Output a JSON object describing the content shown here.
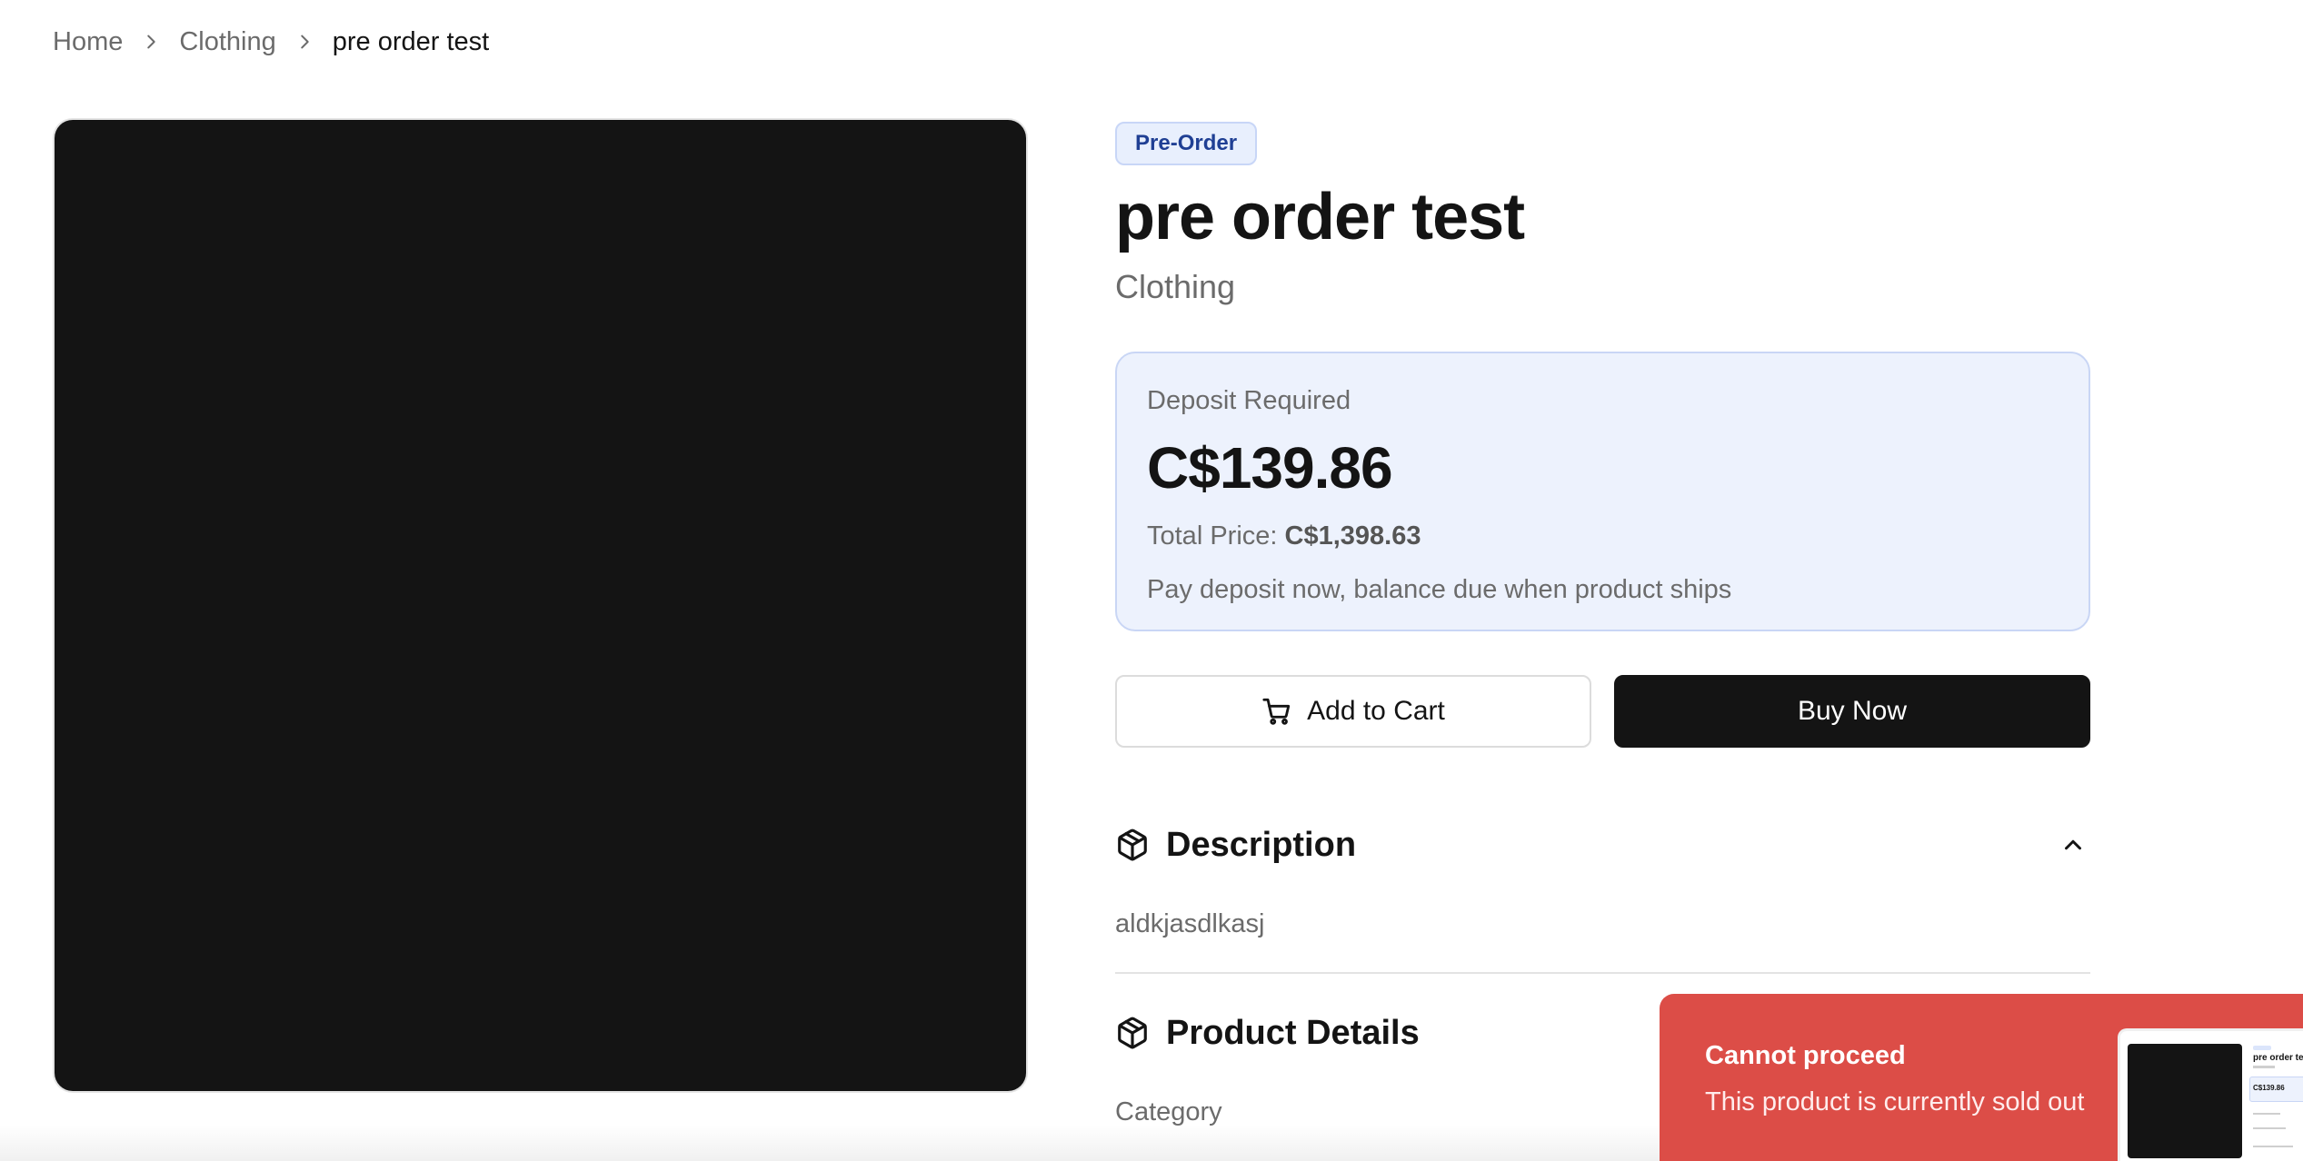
{
  "breadcrumb": {
    "items": [
      "Home",
      "Clothing"
    ],
    "current": "pre order test"
  },
  "product": {
    "badge": "Pre-Order",
    "title": "pre order test",
    "category": "Clothing"
  },
  "pricing": {
    "deposit_label": "Deposit Required",
    "deposit_amount": "C$139.86",
    "total_label": "Total Price:",
    "total_amount": "C$1,398.63",
    "note": "Pay deposit now, balance due when product ships"
  },
  "actions": {
    "add_to_cart_label": "Add to Cart",
    "buy_now_label": "Buy Now"
  },
  "sections": {
    "description_title": "Description",
    "description_text": "aldkjasdlkasj",
    "details_title": "Product Details",
    "details_first_label": "Category"
  },
  "toast": {
    "title": "Cannot proceed",
    "message": "This product is currently sold out"
  },
  "thumbnail": {
    "title": "pre order test",
    "price": "C$139.86"
  },
  "colors": {
    "primary": "#141414",
    "badge_bg": "#e8effd",
    "badge_text": "#1f3f94",
    "price_box_bg": "#edf2fd",
    "toast_bg": "#dc4d47"
  },
  "icons": {
    "breadcrumb_separator": "chevron-right-icon",
    "add_to_cart": "cart-icon",
    "section": "package-icon",
    "collapse": "chevron-up-icon"
  }
}
